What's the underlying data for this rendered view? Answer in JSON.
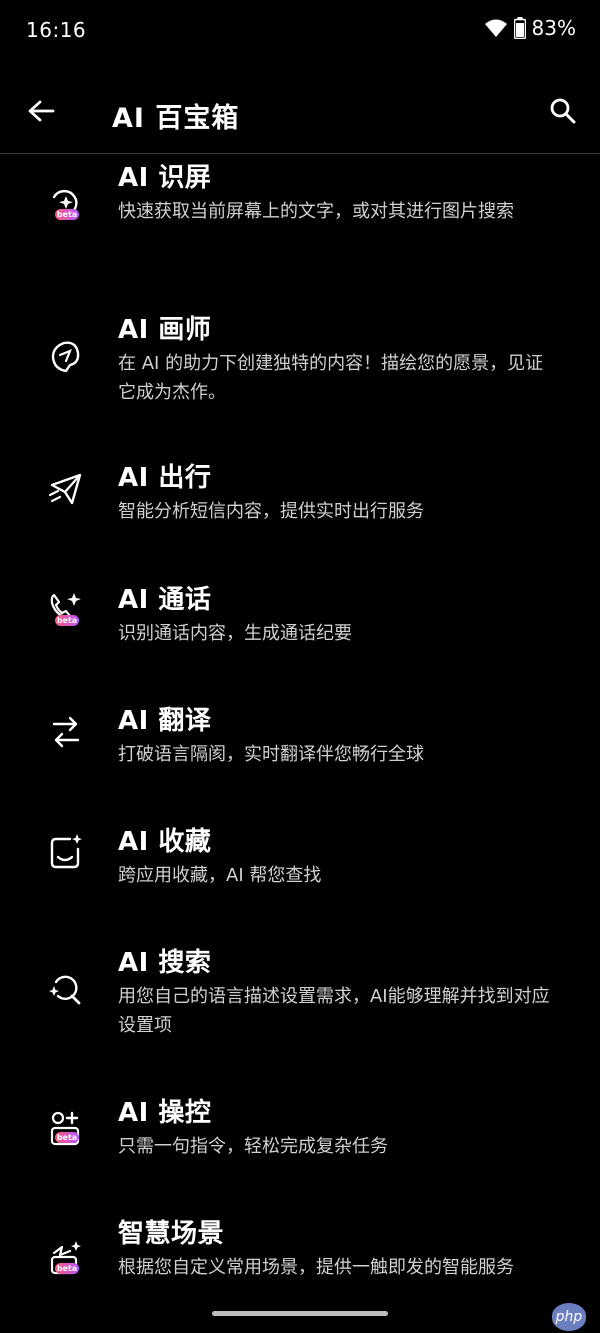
{
  "status_bar": {
    "time": "16:16",
    "battery": "83%"
  },
  "app_bar": {
    "title": "AI 百宝箱"
  },
  "items": [
    {
      "title": "AI 识屏",
      "desc": "快速获取当前屏幕上的文字，或对其进行图片搜索",
      "icon": "screen-recognition-icon",
      "badge": "beta"
    },
    {
      "title": "AI 画师",
      "desc": "在 AI 的助力下创建独特的内容！描绘您的愿景，见证它成为杰作。",
      "icon": "painter-icon"
    },
    {
      "title": "AI 出行",
      "desc": "智能分析短信内容，提供实时出行服务",
      "icon": "travel-icon"
    },
    {
      "title": "AI 通话",
      "desc": "识别通话内容，生成通话纪要",
      "icon": "phone-call-icon",
      "badge": "beta"
    },
    {
      "title": "AI 翻译",
      "desc": "打破语言隔阂，实时翻译伴您畅行全球",
      "icon": "translate-icon"
    },
    {
      "title": "AI 收藏",
      "desc": "跨应用收藏，AI 帮您查找",
      "icon": "collection-icon"
    },
    {
      "title": "AI 搜索",
      "desc": "用您自己的语言描述设置需求，AI能够理解并找到对应设置项",
      "icon": "search-settings-icon"
    },
    {
      "title": "AI 操控",
      "desc": "只需一句指令，轻松完成复杂任务",
      "icon": "control-icon",
      "badge": "beta"
    },
    {
      "title": "智慧场景",
      "desc": "根据您自定义常用场景，提供一触即发的智能服务",
      "icon": "smart-scene-icon",
      "badge": "beta"
    }
  ],
  "watermark": "php"
}
